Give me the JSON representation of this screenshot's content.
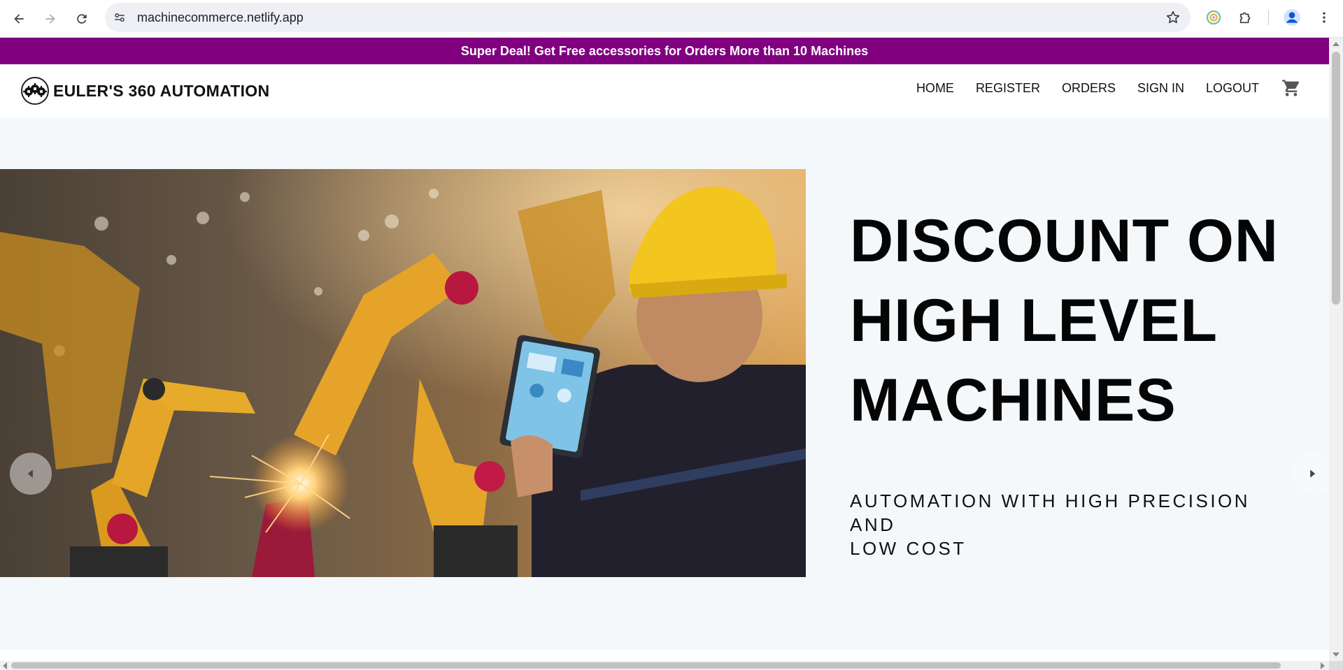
{
  "browser": {
    "url": "machinecommerce.netlify.app",
    "back_icon": "arrow-left-icon",
    "forward_icon": "arrow-right-icon",
    "reload_icon": "reload-icon",
    "site_info_icon": "tune-icon",
    "bookmark_icon": "star-icon",
    "extensions": [
      "google-lens-icon",
      "puzzle-icon"
    ],
    "profile_icon": "avatar-icon",
    "menu_icon": "kebab-menu-icon"
  },
  "promo": {
    "text": "Super Deal! Get Free accessories for Orders More than 10 Machines",
    "background": "#800080"
  },
  "header": {
    "logo_icon": "gears-logo-icon",
    "brand": "EULER'S 360 AUTOMATION",
    "nav": [
      "HOME",
      "REGISTER",
      "ORDERS",
      "SIGN IN",
      "LOGOUT"
    ],
    "cart_icon": "shopping-cart-icon"
  },
  "hero": {
    "title_lines": [
      "DISCOUNT ON",
      "HIGH LEVEL",
      "MACHINES"
    ],
    "subtitle_lines": [
      "AUTOMATION WITH HIGH PRECISION AND",
      "LOW COST"
    ],
    "image_alt": "industrial robotic arms with engineer holding tablet",
    "prev_icon": "caret-left-icon",
    "next_icon": "caret-right-icon",
    "background": "#f4f8fa"
  }
}
